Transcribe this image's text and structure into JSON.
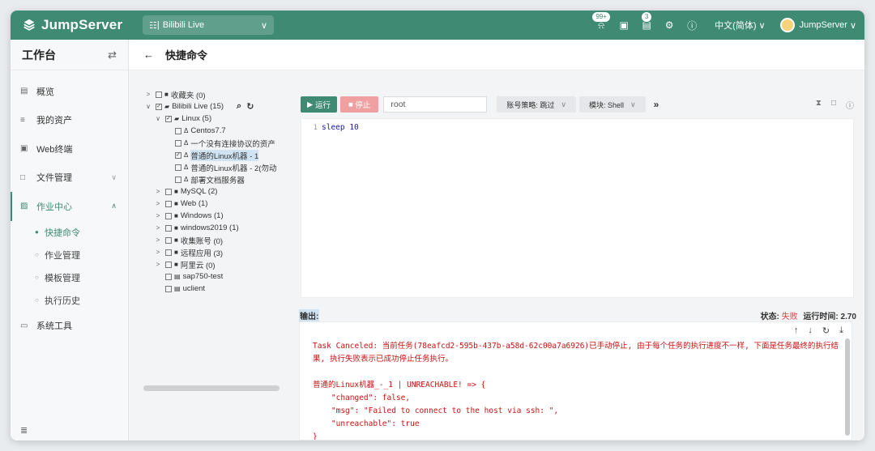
{
  "topbar": {
    "brand": "JumpServer",
    "org": "Bilibili Live",
    "notifications_badge": "99+",
    "tasks_badge": "3",
    "language": "中文(简体)",
    "username": "JumpServer"
  },
  "sidebar": {
    "title": "工作台",
    "items": [
      {
        "label": "概览"
      },
      {
        "label": "我的资产"
      },
      {
        "label": "Web终端"
      },
      {
        "label": "文件管理"
      },
      {
        "label": "作业中心"
      },
      {
        "label": "系统工具"
      }
    ],
    "sub_items": [
      {
        "label": "快捷命令"
      },
      {
        "label": "作业管理"
      },
      {
        "label": "模板管理"
      },
      {
        "label": "执行历史"
      }
    ]
  },
  "page": {
    "title": "快捷命令"
  },
  "tree": {
    "nodes": [
      {
        "label": "收藏夹 (0)"
      },
      {
        "label": "Bilibili Live (15)"
      },
      {
        "label": "Linux (5)"
      },
      {
        "label": "Centos7.7"
      },
      {
        "label": "一个没有连接协议的资产"
      },
      {
        "label": "普通的Linux机器 - 1"
      },
      {
        "label": "普通的Linux机器 - 2(勿动"
      },
      {
        "label": "部署文档服务器"
      },
      {
        "label": "MySQL (2)"
      },
      {
        "label": "Web (1)"
      },
      {
        "label": "Windows (1)"
      },
      {
        "label": "windows2019 (1)"
      },
      {
        "label": "收集账号 (0)"
      },
      {
        "label": "远程应用 (3)"
      },
      {
        "label": "阿里云 (0)"
      },
      {
        "label": "sap750-test"
      },
      {
        "label": "uclient"
      }
    ]
  },
  "toolbar": {
    "run_label": "运行",
    "stop_label": "停止",
    "account_value": "root",
    "account_policy": "账号策略: 跳过",
    "module": "模块: Shell"
  },
  "editor": {
    "line_number": "1",
    "code": "sleep 10"
  },
  "output": {
    "label": "输出:",
    "status_label": "状态:",
    "status_value": "失败",
    "runtime_label": "运行时间: 2.70",
    "text": "Task Canceled: 当前任务(78eafcd2-595b-437b-a58d-62c00a7a6926)已手动停止, 由于每个任务的执行进度不一样, 下面是任务最终的执行结果, 执行失败表示已成功停止任务执行。\n\n普通的Linux机器_-_1 | UNREACHABLE! => {\n    \"changed\": false,\n    \"msg\": \"Failed to connect to the host via ssh: \",\n    \"unreachable\": true\n}"
  },
  "colors": {
    "brand": "#3e8a73",
    "danger": "#e04040"
  }
}
